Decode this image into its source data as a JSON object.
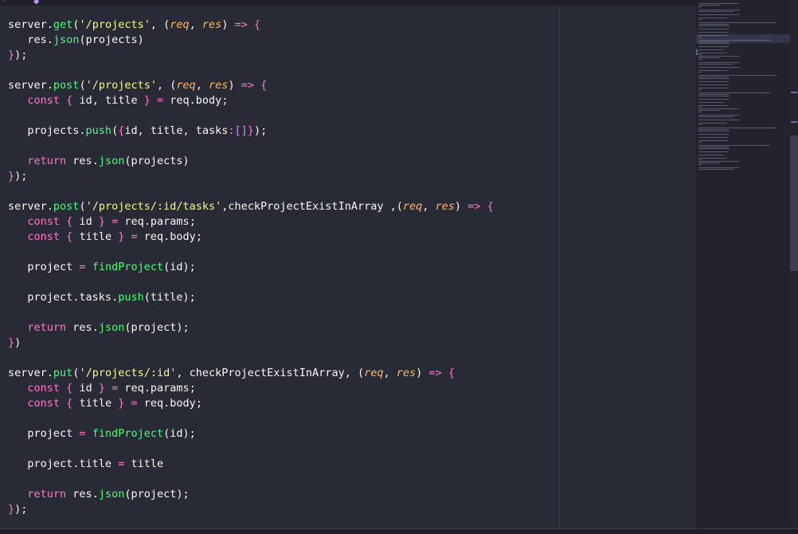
{
  "editor": {
    "lines": [
      [
        [
          "server",
          "ident"
        ],
        [
          ".",
          "punct"
        ],
        [
          "get",
          "fn"
        ],
        [
          "(",
          "paren"
        ],
        [
          "'/projects'",
          "str"
        ],
        [
          ", ",
          "punct"
        ],
        [
          "(",
          "paren"
        ],
        [
          "req",
          "param"
        ],
        [
          ", ",
          "punct"
        ],
        [
          "res",
          "param"
        ],
        [
          ")",
          "paren"
        ],
        [
          " ",
          "ws"
        ],
        [
          "=>",
          "op"
        ],
        [
          " ",
          "ws"
        ],
        [
          "{",
          "brace"
        ]
      ],
      [
        [
          "   res",
          "ident"
        ],
        [
          ".",
          "punct"
        ],
        [
          "json",
          "fn"
        ],
        [
          "(",
          "paren"
        ],
        [
          "projects",
          "ident"
        ],
        [
          ")",
          "paren"
        ]
      ],
      [
        [
          "}",
          "brace"
        ],
        [
          ")",
          "paren"
        ],
        [
          ";",
          "punct"
        ]
      ],
      [],
      [
        [
          "server",
          "ident"
        ],
        [
          ".",
          "punct"
        ],
        [
          "post",
          "fn"
        ],
        [
          "(",
          "paren"
        ],
        [
          "'/projects'",
          "str"
        ],
        [
          ", ",
          "punct"
        ],
        [
          "(",
          "paren"
        ],
        [
          "req",
          "param"
        ],
        [
          ", ",
          "punct"
        ],
        [
          "res",
          "param"
        ],
        [
          ")",
          "paren"
        ],
        [
          " ",
          "ws"
        ],
        [
          "=>",
          "op"
        ],
        [
          " ",
          "ws"
        ],
        [
          "{",
          "brace"
        ]
      ],
      [
        [
          "   ",
          "ws"
        ],
        [
          "const",
          "kw"
        ],
        [
          " ",
          "ws"
        ],
        [
          "{",
          "brace"
        ],
        [
          " id, title ",
          "ident"
        ],
        [
          "}",
          "brace"
        ],
        [
          " ",
          "ws"
        ],
        [
          "=",
          "op"
        ],
        [
          " req",
          "ident"
        ],
        [
          ".",
          "punct"
        ],
        [
          "body",
          "ident"
        ],
        [
          ";",
          "punct"
        ]
      ],
      [],
      [
        [
          "   projects",
          "ident"
        ],
        [
          ".",
          "punct"
        ],
        [
          "push",
          "fn"
        ],
        [
          "(",
          "paren"
        ],
        [
          "{",
          "brace"
        ],
        [
          "id, title, tasks",
          "ident"
        ],
        [
          ":",
          "op"
        ],
        [
          "[]",
          "brack"
        ],
        [
          "}",
          "brace"
        ],
        [
          ")",
          "paren"
        ],
        [
          ";",
          "punct"
        ]
      ],
      [],
      [
        [
          "   ",
          "ws"
        ],
        [
          "return",
          "kw"
        ],
        [
          " res",
          "ident"
        ],
        [
          ".",
          "punct"
        ],
        [
          "json",
          "fn"
        ],
        [
          "(",
          "paren"
        ],
        [
          "projects",
          "ident"
        ],
        [
          ")",
          "paren"
        ]
      ],
      [
        [
          "}",
          "brace"
        ],
        [
          ")",
          "paren"
        ],
        [
          ";",
          "punct"
        ]
      ],
      [],
      [
        [
          "server",
          "ident"
        ],
        [
          ".",
          "punct"
        ],
        [
          "post",
          "fn"
        ],
        [
          "(",
          "paren"
        ],
        [
          "'/projects/:id/tasks'",
          "str"
        ],
        [
          ",checkProjectExistInArray ,",
          "ident"
        ],
        [
          "(",
          "paren"
        ],
        [
          "req",
          "param"
        ],
        [
          ", ",
          "punct"
        ],
        [
          "res",
          "param"
        ],
        [
          ")",
          "paren"
        ],
        [
          " ",
          "ws"
        ],
        [
          "=>",
          "op"
        ],
        [
          " ",
          "ws"
        ],
        [
          "{",
          "brace"
        ]
      ],
      [
        [
          "   ",
          "ws"
        ],
        [
          "const",
          "kw"
        ],
        [
          " ",
          "ws"
        ],
        [
          "{",
          "brace"
        ],
        [
          " id ",
          "ident"
        ],
        [
          "}",
          "brace"
        ],
        [
          " ",
          "ws"
        ],
        [
          "=",
          "op"
        ],
        [
          " req",
          "ident"
        ],
        [
          ".",
          "punct"
        ],
        [
          "params",
          "ident"
        ],
        [
          ";",
          "punct"
        ]
      ],
      [
        [
          "   ",
          "ws"
        ],
        [
          "const",
          "kw"
        ],
        [
          " ",
          "ws"
        ],
        [
          "{",
          "brace"
        ],
        [
          " title ",
          "ident"
        ],
        [
          "}",
          "brace"
        ],
        [
          " ",
          "ws"
        ],
        [
          "=",
          "op"
        ],
        [
          " req",
          "ident"
        ],
        [
          ".",
          "punct"
        ],
        [
          "body",
          "ident"
        ],
        [
          ";",
          "punct"
        ]
      ],
      [],
      [
        [
          "   project ",
          "ident"
        ],
        [
          "=",
          "op"
        ],
        [
          " ",
          "ws"
        ],
        [
          "findProject",
          "fn"
        ],
        [
          "(",
          "paren"
        ],
        [
          "id",
          "ident"
        ],
        [
          ")",
          "paren"
        ],
        [
          ";",
          "punct"
        ]
      ],
      [],
      [
        [
          "   project",
          "ident"
        ],
        [
          ".",
          "punct"
        ],
        [
          "tasks",
          "ident"
        ],
        [
          ".",
          "punct"
        ],
        [
          "push",
          "fn"
        ],
        [
          "(",
          "paren"
        ],
        [
          "title",
          "ident"
        ],
        [
          ")",
          "paren"
        ],
        [
          ";",
          "punct"
        ]
      ],
      [],
      [
        [
          "   ",
          "ws"
        ],
        [
          "return",
          "kw"
        ],
        [
          " res",
          "ident"
        ],
        [
          ".",
          "punct"
        ],
        [
          "json",
          "fn"
        ],
        [
          "(",
          "paren"
        ],
        [
          "project",
          "ident"
        ],
        [
          ")",
          "paren"
        ],
        [
          ";",
          "punct"
        ]
      ],
      [
        [
          "}",
          "brace"
        ],
        [
          ")",
          "paren"
        ]
      ],
      [],
      [
        [
          "server",
          "ident"
        ],
        [
          ".",
          "punct"
        ],
        [
          "put",
          "fn"
        ],
        [
          "(",
          "paren"
        ],
        [
          "'/projects/:id'",
          "str"
        ],
        [
          ", checkProjectExistInArray, ",
          "ident"
        ],
        [
          "(",
          "paren"
        ],
        [
          "req",
          "param"
        ],
        [
          ", ",
          "punct"
        ],
        [
          "res",
          "param"
        ],
        [
          ")",
          "paren"
        ],
        [
          " ",
          "ws"
        ],
        [
          "=>",
          "op"
        ],
        [
          " ",
          "ws"
        ],
        [
          "{",
          "brace"
        ]
      ],
      [
        [
          "   ",
          "ws"
        ],
        [
          "const",
          "kw"
        ],
        [
          " ",
          "ws"
        ],
        [
          "{",
          "brace"
        ],
        [
          " id ",
          "ident"
        ],
        [
          "}",
          "brace"
        ],
        [
          " ",
          "ws"
        ],
        [
          "=",
          "op"
        ],
        [
          " req",
          "ident"
        ],
        [
          ".",
          "punct"
        ],
        [
          "params",
          "ident"
        ],
        [
          ";",
          "punct"
        ]
      ],
      [
        [
          "   ",
          "ws"
        ],
        [
          "const",
          "kw"
        ],
        [
          " ",
          "ws"
        ],
        [
          "{",
          "brace"
        ],
        [
          " title ",
          "ident"
        ],
        [
          "}",
          "brace"
        ],
        [
          " ",
          "ws"
        ],
        [
          "=",
          "op"
        ],
        [
          " req",
          "ident"
        ],
        [
          ".",
          "punct"
        ],
        [
          "body",
          "ident"
        ],
        [
          ";",
          "punct"
        ]
      ],
      [],
      [
        [
          "   project ",
          "ident"
        ],
        [
          "=",
          "op"
        ],
        [
          " ",
          "ws"
        ],
        [
          "findProject",
          "fn"
        ],
        [
          "(",
          "paren"
        ],
        [
          "id",
          "ident"
        ],
        [
          ")",
          "paren"
        ],
        [
          ";",
          "punct"
        ]
      ],
      [],
      [
        [
          "   project",
          "ident"
        ],
        [
          ".",
          "punct"
        ],
        [
          "title ",
          "ident"
        ],
        [
          "=",
          "op"
        ],
        [
          " title",
          "ident"
        ]
      ],
      [],
      [
        [
          "   ",
          "ws"
        ],
        [
          "return",
          "kw"
        ],
        [
          " res",
          "ident"
        ],
        [
          ".",
          "punct"
        ],
        [
          "json",
          "fn"
        ],
        [
          "(",
          "paren"
        ],
        [
          "project",
          "ident"
        ],
        [
          ")",
          "paren"
        ],
        [
          ";",
          "punct"
        ]
      ],
      [
        [
          "}",
          "brace"
        ],
        [
          ")",
          "paren"
        ],
        [
          ";",
          "punct"
        ]
      ]
    ]
  },
  "theme": {
    "background": "#282a36",
    "foreground": "#f8f8f2",
    "function": "#50fa7b",
    "string": "#f1fa8c",
    "parameter": "#ffb86c",
    "keyword": "#ff79c6",
    "bracket": "#bd93f9"
  },
  "icons": {
    "scrollbar": "vertical-scrollbar",
    "minimap": "code-minimap"
  }
}
